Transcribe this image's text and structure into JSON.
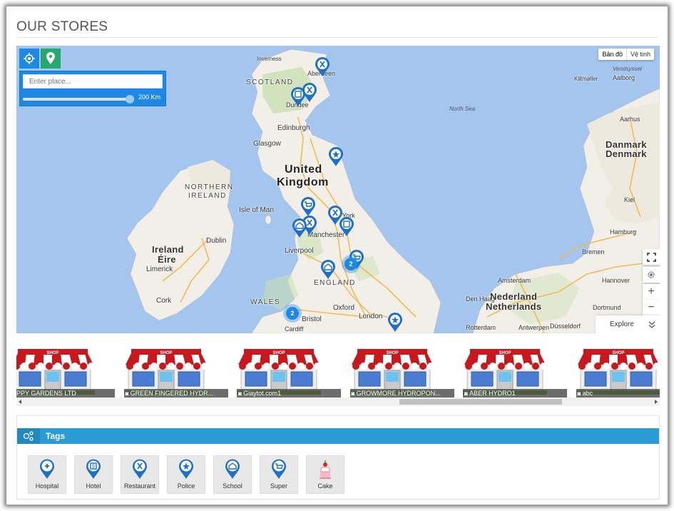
{
  "page": {
    "title": "OUR STORES"
  },
  "map": {
    "type_buttons": [
      {
        "label": "Bản đồ",
        "selected": true
      },
      {
        "label": "Vệ tinh",
        "selected": false
      }
    ],
    "search_placeholder": "Enter place...",
    "radius_label": "200 Km",
    "explore_label": "Explore",
    "colors": {
      "sea": "#a4c6ee",
      "land": "#f2efe9",
      "green": "#c8dfb0",
      "road": "#f5b74a",
      "accent": "#1e88e5",
      "locate": "#1e88e5",
      "pin_btn": "#26a96c"
    },
    "labels": {
      "scotland": "SCOTLAND",
      "inverness": "Inverness",
      "aberdeen": "Aberdeen",
      "dundee": "Dundee",
      "edinburgh": "Edinburgh",
      "glasgow": "Glasgow",
      "uk1": "United",
      "uk2": "Kingdom",
      "ni1": "NORTHERN",
      "ni2": "IRELAND",
      "isle_of_man": "Isle of Man",
      "ireland": "Ireland",
      "eire": "Éire",
      "dublin": "Dublin",
      "limerick": "Limerick",
      "cork": "Cork",
      "york": "York",
      "manchester": "Manchester",
      "liverpool": "Liverpool",
      "england": "ENGLAND",
      "wales": "WALES",
      "bristol": "Bristol",
      "cardiff": "Cardiff",
      "oxford": "Oxford",
      "london": "London",
      "north_sea": "North Sea",
      "vendsyssel": "Vendsyssel",
      "aalborg": "Aalborg",
      "klitmoller": "Klitmøller",
      "aarhus": "Aarhus",
      "denmark1": "Danmark",
      "denmark2": "Denmark",
      "kiel": "Kiel",
      "hamburg": "Hamburg",
      "bremen": "Bremen",
      "amsterdam": "Amsterdam",
      "hannover": "Hannover",
      "denhaag": "Den Haag",
      "nederland": "Nederland",
      "netherlands": "Netherlands",
      "dortmund": "Dortmund",
      "rotterdam": "Rotterdam",
      "antwerpen": "Antwerpen",
      "dusseldorf": "Düsseldorf"
    },
    "clusters": [
      {
        "count": "2"
      },
      {
        "count": "2"
      }
    ]
  },
  "stores": [
    {
      "name": "APPY GARDENS LTD"
    },
    {
      "name": "GREEN FINGERED HYDR..."
    },
    {
      "name": "Giaytot.com1"
    },
    {
      "name": "GROWMORE HYDROPON..."
    },
    {
      "name": "ABER HYDRO1"
    },
    {
      "name": "abc"
    }
  ],
  "tags": {
    "heading": "Tags",
    "items": [
      {
        "label": "Hospital",
        "icon": "hospital-icon"
      },
      {
        "label": "Hotel",
        "icon": "hotel-icon"
      },
      {
        "label": "Restaurant",
        "icon": "restaurant-icon"
      },
      {
        "label": "Police",
        "icon": "police-icon"
      },
      {
        "label": "School",
        "icon": "school-icon"
      },
      {
        "label": "Super",
        "icon": "supermarket-icon"
      },
      {
        "label": "Cake",
        "icon": "cake-icon"
      }
    ]
  }
}
